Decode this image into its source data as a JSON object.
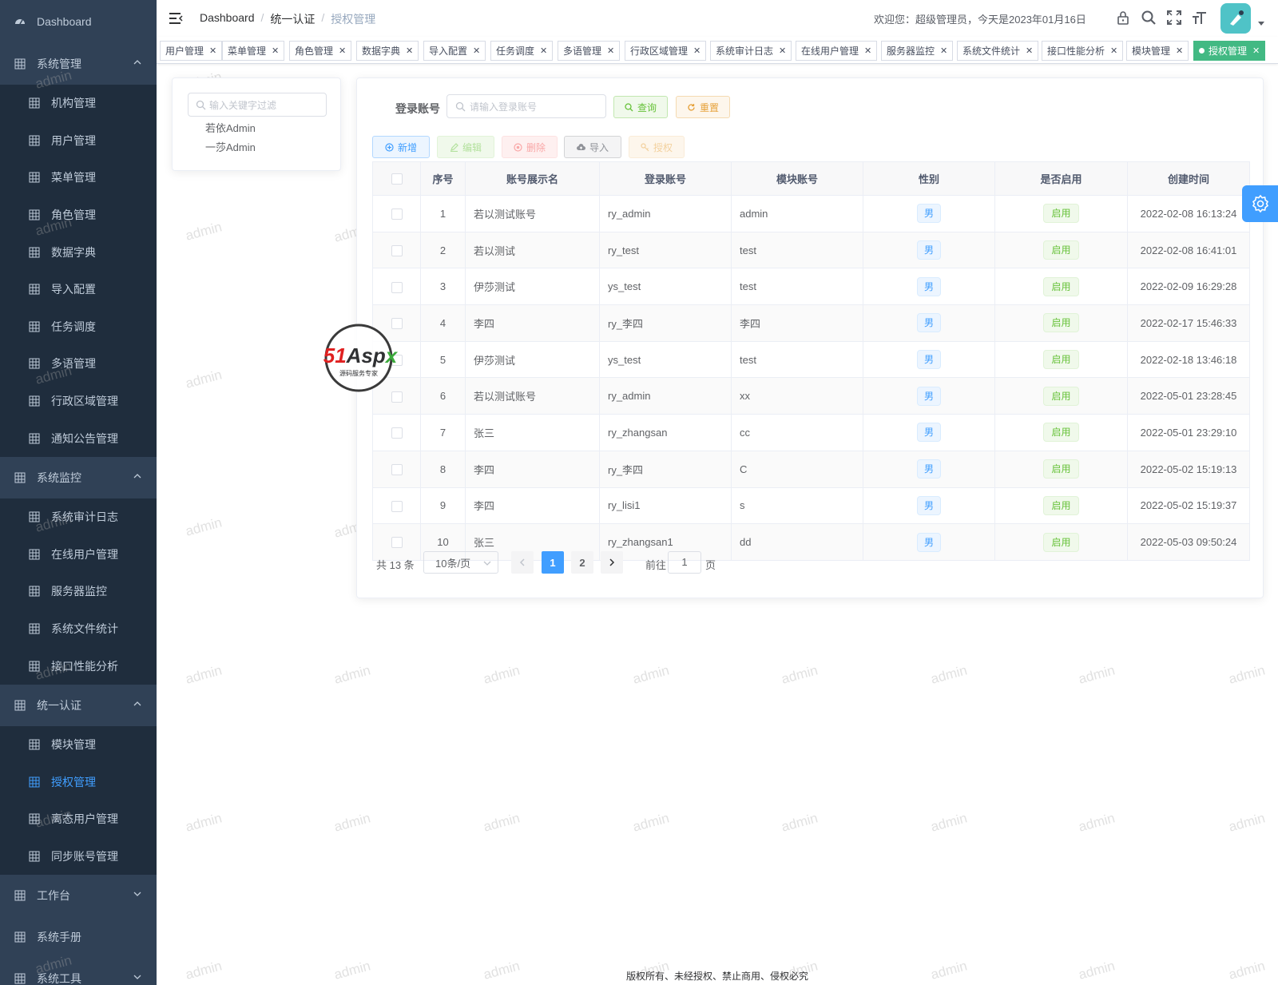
{
  "sidebar": {
    "dashboard": "Dashboard",
    "groups": [
      {
        "label": "系统管理",
        "items": [
          "机构管理",
          "用户管理",
          "菜单管理",
          "角色管理",
          "数据字典",
          "导入配置",
          "任务调度",
          "多语管理",
          "行政区域管理",
          "通知公告管理"
        ]
      },
      {
        "label": "系统监控",
        "items": [
          "系统审计日志",
          "在线用户管理",
          "服务器监控",
          "系统文件统计",
          "接口性能分析"
        ]
      },
      {
        "label": "统一认证",
        "items": [
          "模块管理",
          "授权管理",
          "离态用户管理",
          "同步账号管理"
        ]
      },
      {
        "label": "工作台"
      },
      {
        "label": "系统手册"
      },
      {
        "label": "系统工具"
      }
    ]
  },
  "navbar": {
    "breadcrumb": [
      "Dashboard",
      "统一认证",
      "授权管理"
    ],
    "welcome": "欢迎您：超级管理员，今天是2023年01月16日"
  },
  "tags": [
    "用户管理",
    "菜单管理",
    "角色管理",
    "数据字典",
    "导入配置",
    "任务调度",
    "多语管理",
    "行政区域管理",
    "系统审计日志",
    "在线用户管理",
    "服务器监控",
    "系统文件统计",
    "接口性能分析",
    "模块管理",
    "授权管理"
  ],
  "tree": {
    "placeholder": "输入关键字过滤",
    "nodes": [
      "若依Admin",
      "一莎Admin"
    ]
  },
  "query": {
    "label": "登录账号",
    "placeholder": "请输入登录账号",
    "search": "查询",
    "reset": "重置"
  },
  "toolbar": {
    "add": "新增",
    "edit": "编辑",
    "delete": "删除",
    "import": "导入",
    "auth": "授权"
  },
  "table": {
    "headers": [
      "序号",
      "账号展示名",
      "登录账号",
      "模块账号",
      "性别",
      "是否启用",
      "创建时间"
    ],
    "rows": [
      {
        "no": "1",
        "name": "若以测试账号",
        "login": "ry_admin",
        "module": "admin",
        "sex": "男",
        "enabled": "启用",
        "created": "2022-02-08 16:13:24"
      },
      {
        "no": "2",
        "name": "若以测试",
        "login": "ry_test",
        "module": "test",
        "sex": "男",
        "enabled": "启用",
        "created": "2022-02-08 16:41:01"
      },
      {
        "no": "3",
        "name": "伊莎测试",
        "login": "ys_test",
        "module": "test",
        "sex": "男",
        "enabled": "启用",
        "created": "2022-02-09 16:29:28"
      },
      {
        "no": "4",
        "name": "李四",
        "login": "ry_李四",
        "module": "李四",
        "sex": "男",
        "enabled": "启用",
        "created": "2022-02-17 15:46:33"
      },
      {
        "no": "5",
        "name": "伊莎测试",
        "login": "ys_test",
        "module": "test",
        "sex": "男",
        "enabled": "启用",
        "created": "2022-02-18 13:46:18"
      },
      {
        "no": "6",
        "name": "若以测试账号",
        "login": "ry_admin",
        "module": "xx",
        "sex": "男",
        "enabled": "启用",
        "created": "2022-05-01 23:28:45"
      },
      {
        "no": "7",
        "name": "张三",
        "login": "ry_zhangsan",
        "module": "cc",
        "sex": "男",
        "enabled": "启用",
        "created": "2022-05-01 23:29:10"
      },
      {
        "no": "8",
        "name": "李四",
        "login": "ry_李四",
        "module": "C",
        "sex": "男",
        "enabled": "启用",
        "created": "2022-05-02 15:19:13"
      },
      {
        "no": "9",
        "name": "李四",
        "login": "ry_lisi1",
        "module": "s",
        "sex": "男",
        "enabled": "启用",
        "created": "2022-05-02 15:19:37"
      },
      {
        "no": "10",
        "name": "张三",
        "login": "ry_zhangsan1",
        "module": "dd",
        "sex": "男",
        "enabled": "启用",
        "created": "2022-05-03 09:50:24"
      }
    ]
  },
  "pagination": {
    "total": "共 13 条",
    "page_size": "10条/页",
    "pages": [
      "1",
      "2"
    ],
    "goto_label": "前往",
    "goto_value": "1",
    "page_suffix": "页"
  },
  "watermark": "admin",
  "logo": {
    "brand": "51Aspx",
    "tagline": "源码服务专家"
  },
  "footer": "版权所有、未经授权、禁止商用、侵权必究",
  "icons": [
    "dashboard-icon",
    "grid-icon",
    "chevron-up-icon",
    "chevron-down-icon",
    "hamburger-icon",
    "lock-icon",
    "search-icon",
    "fullscreen-icon",
    "font-size-icon",
    "refresh-icon",
    "plus-icon",
    "edit-icon",
    "delete-icon",
    "upload-icon",
    "key-icon",
    "settings-icon"
  ],
  "colors": {
    "sidebar_bg": "#304156",
    "sidebar_sub_bg": "#1f2d3d",
    "primary": "#409eff",
    "success": "#67c23a",
    "active_tag": "#42b983",
    "warning": "#e6a23c"
  }
}
